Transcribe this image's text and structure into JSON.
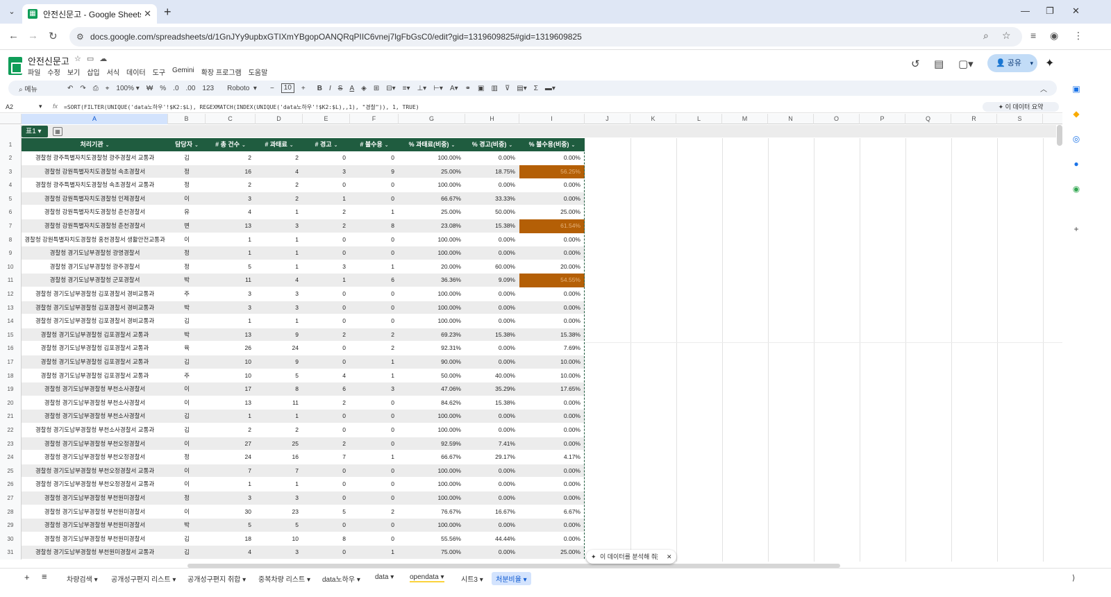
{
  "browser": {
    "tab_title": "안전신문고 - Google Sheets",
    "url": "docs.google.com/spreadsheets/d/1GnJYy9upbxGTIXmYBgopOANQRqPIIC6vnej7lgFbGsC0/edit?gid=1319609825#gid=1319609825"
  },
  "doc": {
    "title": "안전신문고",
    "menus": [
      "파일",
      "수정",
      "보기",
      "삽입",
      "서식",
      "데이터",
      "도구",
      "Gemini",
      "확장 프로그램",
      "도움말"
    ],
    "share_label": "공유"
  },
  "toolbar": {
    "search": "메뉴",
    "zoom": "100%",
    "currency": "₩",
    "percent": "%",
    "dec_dec": ".0",
    "dec_inc": ".00",
    "numfmt": "123",
    "font": "Roboto",
    "font_size": "10"
  },
  "formula_bar": {
    "cell_ref": "A2",
    "formula": "=SORT(FILTER(UNIQUE('data노하우'!$K2:$L), REGEXMATCH(INDEX(UNIQUE('data노하우'!$K2:$L),,1), \"경찰\")), 1, TRUE)",
    "summary": "이 데이터 요약"
  },
  "columns": [
    "A",
    "B",
    "C",
    "D",
    "E",
    "F",
    "G",
    "H",
    "I",
    "J",
    "K",
    "L",
    "M",
    "N",
    "O",
    "P",
    "Q",
    "R",
    "S"
  ],
  "table": {
    "name": "표1",
    "headers": [
      "처리기관",
      "담당자",
      "#  총 건수",
      "#  과태료",
      "#  경고",
      "#  불수용",
      "%  과태료(비중)",
      "%  경고(비중)",
      "%  불수용(비중)"
    ],
    "rows": [
      {
        "n": "2",
        "a": "경찰청 광주특별자치도경찰청 광주경찰서 교통과",
        "b": "김",
        "c": "2",
        "d": "2",
        "e": "0",
        "f": "0",
        "g": "100.00%",
        "h": "0.00%",
        "i": "0.00%",
        "hl": false
      },
      {
        "n": "3",
        "a": "경찰청 강원특별자치도경찰청 속초경찰서",
        "b": "정",
        "c": "16",
        "d": "4",
        "e": "3",
        "f": "9",
        "g": "25.00%",
        "h": "18.75%",
        "i": "56.25%",
        "hl": true
      },
      {
        "n": "4",
        "a": "경찰청 광주특별자치도경찰청 속초경찰서 교통과",
        "b": "정",
        "c": "2",
        "d": "2",
        "e": "0",
        "f": "0",
        "g": "100.00%",
        "h": "0.00%",
        "i": "0.00%",
        "hl": false
      },
      {
        "n": "5",
        "a": "경찰청 강원특별자치도경찰청 인제경찰서",
        "b": "이",
        "c": "3",
        "d": "2",
        "e": "1",
        "f": "0",
        "g": "66.67%",
        "h": "33.33%",
        "i": "0.00%",
        "hl": false
      },
      {
        "n": "6",
        "a": "경찰청 강원특별자치도경찰청 춘천경찰서",
        "b": "유",
        "c": "4",
        "d": "1",
        "e": "2",
        "f": "1",
        "g": "25.00%",
        "h": "50.00%",
        "i": "25.00%",
        "hl": false
      },
      {
        "n": "7",
        "a": "경찰청 강원특별자치도경찰청 춘천경찰서",
        "b": "변",
        "c": "13",
        "d": "3",
        "e": "2",
        "f": "8",
        "g": "23.08%",
        "h": "15.38%",
        "i": "61.54%",
        "hl": true
      },
      {
        "n": "8",
        "a": "경찰청 강원특별자치도경찰청 홍천경찰서 생활안전교통과",
        "b": "이",
        "c": "1",
        "d": "1",
        "e": "0",
        "f": "0",
        "g": "100.00%",
        "h": "0.00%",
        "i": "0.00%",
        "hl": false
      },
      {
        "n": "9",
        "a": "경찰청 경기도남부경찰청 광명경찰서",
        "b": "정",
        "c": "1",
        "d": "1",
        "e": "0",
        "f": "0",
        "g": "100.00%",
        "h": "0.00%",
        "i": "0.00%",
        "hl": false
      },
      {
        "n": "10",
        "a": "경찰청 경기도남부경찰청 광주경찰서",
        "b": "정",
        "c": "5",
        "d": "1",
        "e": "3",
        "f": "1",
        "g": "20.00%",
        "h": "60.00%",
        "i": "20.00%",
        "hl": false
      },
      {
        "n": "11",
        "a": "경찰청 경기도남부경찰청 군포경찰서",
        "b": "박",
        "c": "11",
        "d": "4",
        "e": "1",
        "f": "6",
        "g": "36.36%",
        "h": "9.09%",
        "i": "54.55%",
        "hl": true
      },
      {
        "n": "12",
        "a": "경찰청 경기도남부경찰청 김포경찰서 경비교통과",
        "b": "주",
        "c": "3",
        "d": "3",
        "e": "0",
        "f": "0",
        "g": "100.00%",
        "h": "0.00%",
        "i": "0.00%",
        "hl": false
      },
      {
        "n": "13",
        "a": "경찰청 경기도남부경찰청 김포경찰서 경비교통과",
        "b": "박",
        "c": "3",
        "d": "3",
        "e": "0",
        "f": "0",
        "g": "100.00%",
        "h": "0.00%",
        "i": "0.00%",
        "hl": false
      },
      {
        "n": "14",
        "a": "경찰청 경기도남부경찰청 김포경찰서 경비교통과",
        "b": "김",
        "c": "1",
        "d": "1",
        "e": "0",
        "f": "0",
        "g": "100.00%",
        "h": "0.00%",
        "i": "0.00%",
        "hl": false
      },
      {
        "n": "15",
        "a": "경찰청 경기도남부경찰청 김포경찰서 교통과",
        "b": "박",
        "c": "13",
        "d": "9",
        "e": "2",
        "f": "2",
        "g": "69.23%",
        "h": "15.38%",
        "i": "15.38%",
        "hl": false
      },
      {
        "n": "16",
        "a": "경찰청 경기도남부경찰청 김포경찰서 교통과",
        "b": "육",
        "c": "26",
        "d": "24",
        "e": "0",
        "f": "2",
        "g": "92.31%",
        "h": "0.00%",
        "i": "7.69%",
        "hl": false
      },
      {
        "n": "17",
        "a": "경찰청 경기도남부경찰청 김포경찰서 교통과",
        "b": "김",
        "c": "10",
        "d": "9",
        "e": "0",
        "f": "1",
        "g": "90.00%",
        "h": "0.00%",
        "i": "10.00%",
        "hl": false
      },
      {
        "n": "18",
        "a": "경찰청 경기도남부경찰청 김포경찰서 교통과",
        "b": "주",
        "c": "10",
        "d": "5",
        "e": "4",
        "f": "1",
        "g": "50.00%",
        "h": "40.00%",
        "i": "10.00%",
        "hl": false
      },
      {
        "n": "19",
        "a": "경찰청 경기도남부경찰청 부천소사경찰서",
        "b": "이",
        "c": "17",
        "d": "8",
        "e": "6",
        "f": "3",
        "g": "47.06%",
        "h": "35.29%",
        "i": "17.65%",
        "hl": false
      },
      {
        "n": "20",
        "a": "경찰청 경기도남부경찰청 부천소사경찰서",
        "b": "이",
        "c": "13",
        "d": "11",
        "e": "2",
        "f": "0",
        "g": "84.62%",
        "h": "15.38%",
        "i": "0.00%",
        "hl": false
      },
      {
        "n": "21",
        "a": "경찰청 경기도남부경찰청 부천소사경찰서",
        "b": "김",
        "c": "1",
        "d": "1",
        "e": "0",
        "f": "0",
        "g": "100.00%",
        "h": "0.00%",
        "i": "0.00%",
        "hl": false
      },
      {
        "n": "22",
        "a": "경찰청 경기도남부경찰청 부천소사경찰서 교통과",
        "b": "김",
        "c": "2",
        "d": "2",
        "e": "0",
        "f": "0",
        "g": "100.00%",
        "h": "0.00%",
        "i": "0.00%",
        "hl": false
      },
      {
        "n": "23",
        "a": "경찰청 경기도남부경찰청 부천오정경찰서",
        "b": "이",
        "c": "27",
        "d": "25",
        "e": "2",
        "f": "0",
        "g": "92.59%",
        "h": "7.41%",
        "i": "0.00%",
        "hl": false
      },
      {
        "n": "24",
        "a": "경찰청 경기도남부경찰청 부천오정경찰서",
        "b": "정",
        "c": "24",
        "d": "16",
        "e": "7",
        "f": "1",
        "g": "66.67%",
        "h": "29.17%",
        "i": "4.17%",
        "hl": false
      },
      {
        "n": "25",
        "a": "경찰청 경기도남부경찰청 부천오정경찰서 교통과",
        "b": "이",
        "c": "7",
        "d": "7",
        "e": "0",
        "f": "0",
        "g": "100.00%",
        "h": "0.00%",
        "i": "0.00%",
        "hl": false
      },
      {
        "n": "26",
        "a": "경찰청 경기도남부경찰청 부천오정경찰서 교통과",
        "b": "이",
        "c": "1",
        "d": "1",
        "e": "0",
        "f": "0",
        "g": "100.00%",
        "h": "0.00%",
        "i": "0.00%",
        "hl": false
      },
      {
        "n": "27",
        "a": "경찰청 경기도남부경찰청 부천원미경찰서",
        "b": "정",
        "c": "3",
        "d": "3",
        "e": "0",
        "f": "0",
        "g": "100.00%",
        "h": "0.00%",
        "i": "0.00%",
        "hl": false
      },
      {
        "n": "28",
        "a": "경찰청 경기도남부경찰청 부천원미경찰서",
        "b": "이",
        "c": "30",
        "d": "23",
        "e": "5",
        "f": "2",
        "g": "76.67%",
        "h": "16.67%",
        "i": "6.67%",
        "hl": false
      },
      {
        "n": "29",
        "a": "경찰청 경기도남부경찰청 부천원미경찰서",
        "b": "박",
        "c": "5",
        "d": "5",
        "e": "0",
        "f": "0",
        "g": "100.00%",
        "h": "0.00%",
        "i": "0.00%",
        "hl": false
      },
      {
        "n": "30",
        "a": "경찰청 경기도남부경찰청 부천원미경찰서",
        "b": "김",
        "c": "18",
        "d": "10",
        "e": "8",
        "f": "0",
        "g": "55.56%",
        "h": "44.44%",
        "i": "0.00%",
        "hl": false
      },
      {
        "n": "31",
        "a": "경찰청 경기도남부경찰청 부천원미경찰서 교통과",
        "b": "김",
        "c": "4",
        "d": "3",
        "e": "0",
        "f": "1",
        "g": "75.00%",
        "h": "0.00%",
        "i": "25.00%",
        "hl": false
      }
    ]
  },
  "popup": {
    "label": "이 데이터를 분석해 줘"
  },
  "sheet_tabs": [
    "차량검색",
    "공개성구편지 리스트",
    "공개성구편지 취합",
    "중복차량 리스트",
    "data노하우",
    "data",
    "opendata",
    "시트3",
    "처분비율"
  ],
  "active_sheet": "처분비율",
  "colors": {
    "accent": "#1f5c3f",
    "highlight": "#b45f06",
    "selection": "#d3e3fd"
  }
}
